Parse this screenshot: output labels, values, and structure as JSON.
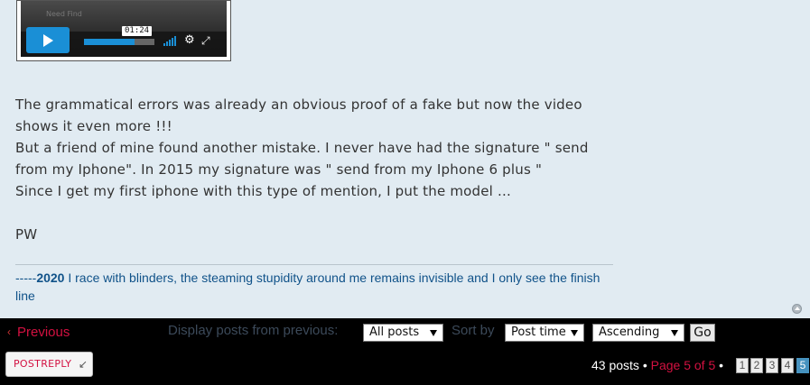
{
  "video": {
    "watermark": "Need Find",
    "timestamp": "01:24",
    "progress_fraction": 0.72
  },
  "post": {
    "paragraphs": [
      "The grammatical errors was already an obvious proof of a fake but now the video shows it even more !!!",
      "But a friend of mine found another mistake. I never have had the signature \" send from my Iphone\". In 2015 my signature was \" send from my Iphone 6 plus \"",
      "Since I get my first iphone with this type of mention, I put the model ..."
    ],
    "sign_off": "PW"
  },
  "signature": {
    "prefix": "-----",
    "year": "2020",
    "text": " I race with blinders, the steaming stupidity around me remains invisible and I only see the finish line"
  },
  "action_bar": {
    "previous_chevron": "‹",
    "previous_label": "Previous",
    "display_label": "Display posts from previous:",
    "display_value": "All posts",
    "sort_label": "Sort by",
    "sort_field_value": "Post time",
    "sort_order_value": "Ascending",
    "go_label": "Go"
  },
  "bottom_bar": {
    "post_reply_label": "POSTREPLY",
    "post_reply_icon": "↙",
    "post_count": "43 posts",
    "bullet": "•",
    "page_of": "Page 5 of 5",
    "pages": [
      "1",
      "2",
      "3",
      "4",
      "5"
    ],
    "current_page": "5"
  },
  "colors": {
    "background": "#e1ebf2",
    "accent_red": "#d31141",
    "link_blue": "#105289",
    "active_page": "#4692bf"
  }
}
